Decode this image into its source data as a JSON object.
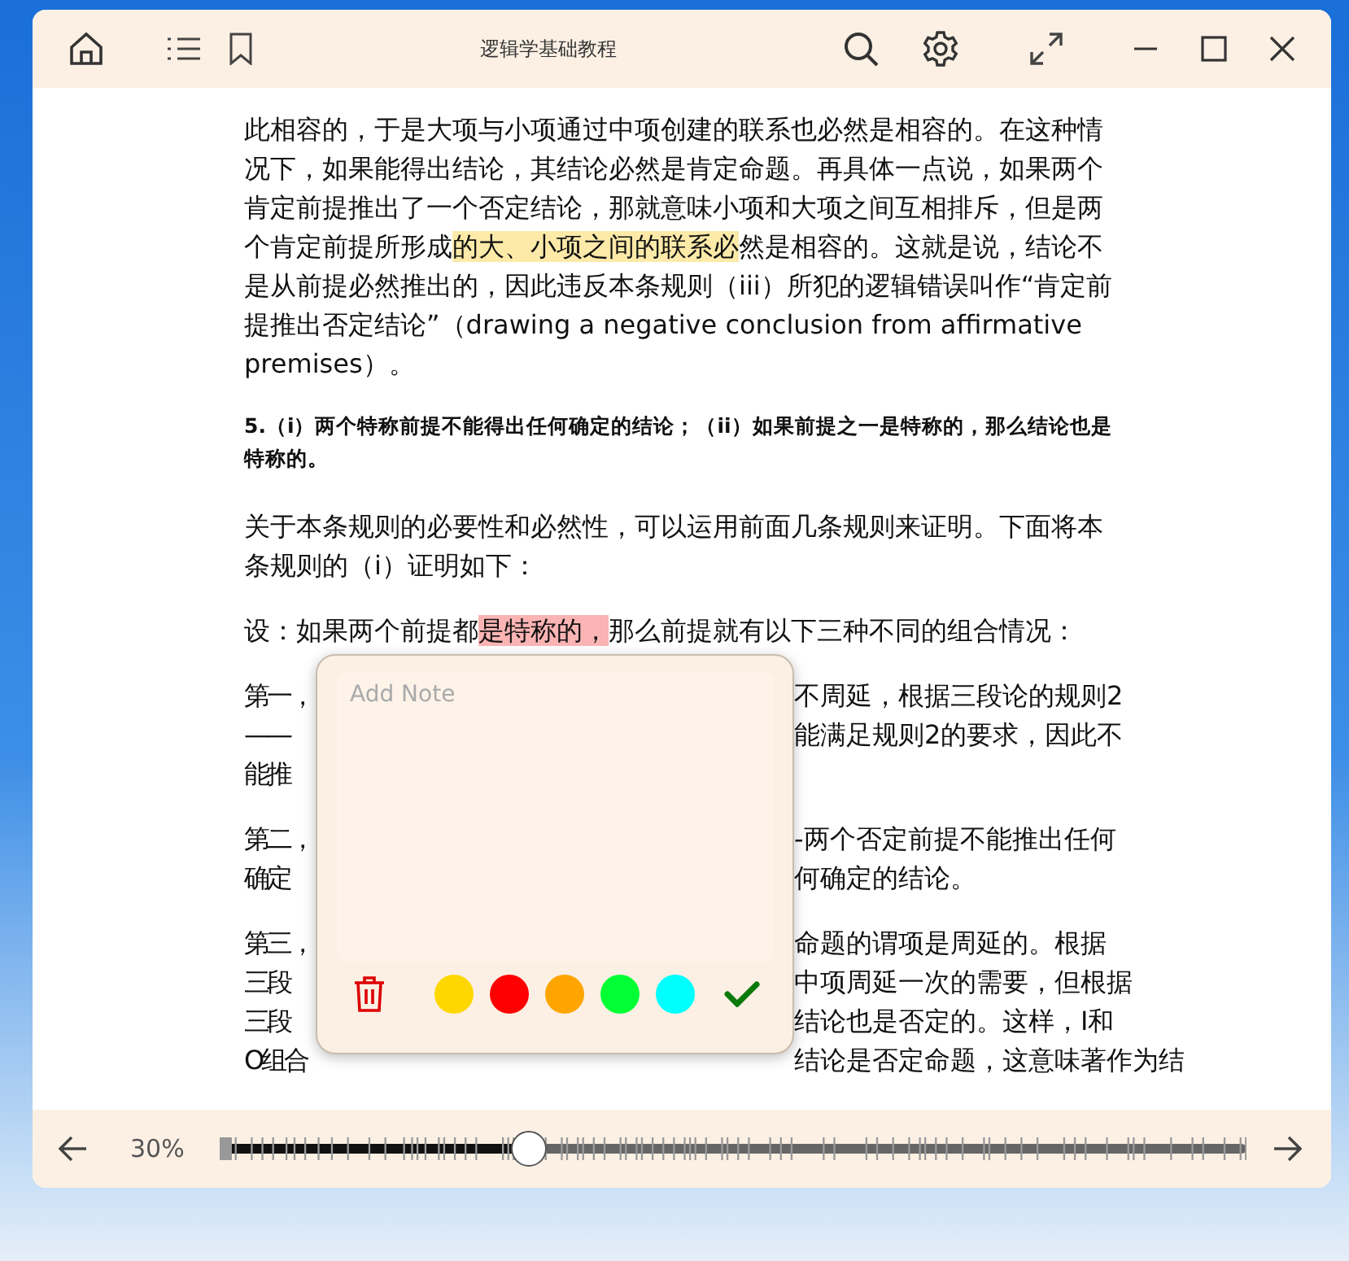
{
  "window": {
    "title": "逻辑学基础教程"
  },
  "paragraphs": [
    {
      "kind": "text",
      "segments": [
        {
          "text": "此相容的，于是大项与小项通过中项创建的联系也必然是相容的。在这种情况下，如果能得出结论，其结论必然是肯定命题。再具体一点说，如果两个肯定前提推出了一个否定结论，那就意味小项和大项之间互相排斥，但是两个肯定前提所形成"
        },
        {
          "text": "的大、小项之间的联系必",
          "color": "#fdeaa8"
        },
        {
          "text": "然是相容的。这就是说，结论不是从前提必然推出的，因此违反本条规则（iii）所犯的逻辑错误叫作“肯定前提推出否定结论”（drawing a negative conclusion from affirmative premises）。"
        }
      ]
    },
    {
      "kind": "heading",
      "segments": [
        {
          "text": "5.（i）两个特称前提不能得出任何确定的结论；（ii）如果前提之一是特称的，那么结论也是特称的。"
        }
      ]
    },
    {
      "kind": "text",
      "segments": [
        {
          "text": "关于本条规则的必要性和必然性，可以运用前面几条规则来证明。下面将本条规则的（i）证明如下："
        }
      ]
    },
    {
      "kind": "text",
      "segments": [
        {
          "text": "设：如果两个前提都"
        },
        {
          "text": "是特称的，",
          "color": "#fbb4b4"
        },
        {
          "text": "那么前提就有以下三种不同的组合情况："
        }
      ]
    },
    {
      "kind": "covered",
      "lines": [
        {
          "left": "第一，",
          "right": "不周延，根据三段论的规则2"
        },
        {
          "left": "——",
          "right": "能满足规则2的要求，因此不"
        },
        {
          "left": "能推"
        }
      ]
    },
    {
      "kind": "covered",
      "lines": [
        {
          "left": "第二，",
          "right": "-两个否定前提不能推出任何"
        },
        {
          "left": "确定",
          "right": "何确定的结论。"
        }
      ]
    },
    {
      "kind": "covered",
      "lines": [
        {
          "left": "第三，",
          "right": "命题的谓项是周延的。根据"
        },
        {
          "left": "三段",
          "right": "中项周延一次的需要，但根据"
        },
        {
          "left": "三段",
          "right": "结论也是否定的。这样，I和"
        },
        {
          "left": "O组合",
          "right": "结论是否定命题，这意味著作为结"
        }
      ]
    }
  ],
  "note_popup": {
    "placeholder": "Add Note",
    "colors": [
      {
        "color": "#ffd700"
      },
      {
        "color": "#ff0000"
      },
      {
        "color": "#ffa500"
      },
      {
        "color": "#00ff33"
      },
      {
        "color": "#00ffff"
      }
    ]
  },
  "footer": {
    "progress_text": "30%",
    "progress": {
      "level": 0.3
    }
  }
}
